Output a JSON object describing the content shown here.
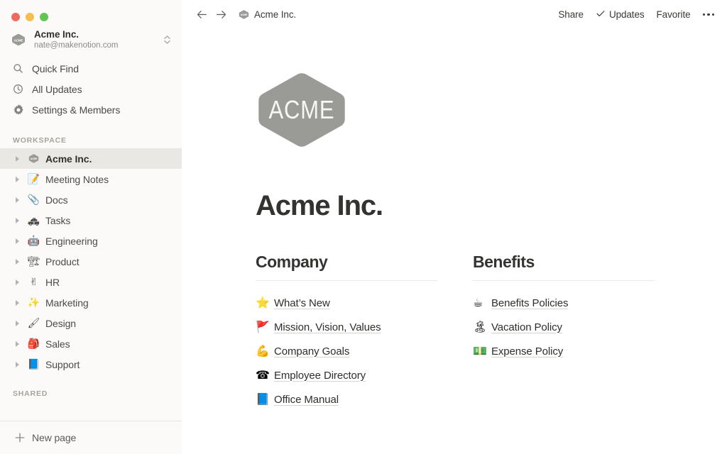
{
  "window": {
    "traffic_lights": [
      {
        "name": "close",
        "color": "#ec6a5f"
      },
      {
        "name": "minimize",
        "color": "#f4bf4f"
      },
      {
        "name": "maximize",
        "color": "#61c554"
      }
    ]
  },
  "sidebar": {
    "workspace": {
      "name": "Acme Inc.",
      "email": "nate@makenotion.com",
      "logo_text": "ACME",
      "switcher_icon": "chevron-up-down-icon"
    },
    "nav": [
      {
        "label": "Quick Find",
        "icon": "search-icon"
      },
      {
        "label": "All Updates",
        "icon": "clock-icon"
      },
      {
        "label": "Settings & Members",
        "icon": "gear-icon"
      }
    ],
    "workspace_section": {
      "title": "WORKSPACE",
      "pages": [
        {
          "label": "Acme Inc.",
          "emoji": "",
          "icon": "acme-hex-icon",
          "selected": true
        },
        {
          "label": "Meeting Notes",
          "emoji": "📝",
          "icon": "memo-emoji",
          "selected": false
        },
        {
          "label": "Docs",
          "emoji": "📎",
          "icon": "paperclip-emoji",
          "selected": false
        },
        {
          "label": "Tasks",
          "emoji": "🚓",
          "icon": "police-car-emoji",
          "selected": false
        },
        {
          "label": "Engineering",
          "emoji": "🤖",
          "icon": "robot-emoji",
          "selected": false
        },
        {
          "label": "Product",
          "emoji": "🏗",
          "icon": "crane-emoji",
          "selected": false
        },
        {
          "label": "HR",
          "emoji": "✌",
          "icon": "victory-hand-emoji",
          "selected": false
        },
        {
          "label": "Marketing",
          "emoji": "✨",
          "icon": "sparkles-emoji",
          "selected": false
        },
        {
          "label": "Design",
          "emoji": "🖌",
          "icon": "paintbrush-emoji",
          "selected": false
        },
        {
          "label": "Sales",
          "emoji": "🎒",
          "icon": "backpack-emoji",
          "selected": false
        },
        {
          "label": "Support",
          "emoji": "📘",
          "icon": "blue-book-emoji",
          "selected": false
        }
      ]
    },
    "shared_section": {
      "title": "SHARED",
      "pages": []
    },
    "new_page": {
      "label": "New page",
      "icon": "plus-icon"
    }
  },
  "topbar": {
    "back_icon": "arrow-left-icon",
    "forward_icon": "arrow-right-icon",
    "breadcrumb": {
      "label": "Acme Inc.",
      "icon": "acme-hex-icon"
    },
    "actions": [
      {
        "label": "Share",
        "icon": ""
      },
      {
        "label": "Updates",
        "icon": "check-icon"
      },
      {
        "label": "Favorite",
        "icon": ""
      }
    ],
    "more_icon": "ellipsis-icon"
  },
  "page": {
    "logo_text": "ACME",
    "title": "Acme Inc.",
    "columns": [
      {
        "heading": "Company",
        "links": [
          {
            "label": "What’s New",
            "emoji": "⭐",
            "icon": "star-emoji"
          },
          {
            "label": "Mission, Vision, Values",
            "emoji": "🚩",
            "icon": "triangular-flag-emoji"
          },
          {
            "label": "Company Goals",
            "emoji": "💪",
            "icon": "flexed-biceps-emoji"
          },
          {
            "label": "Employee Directory",
            "emoji": "☎",
            "icon": "telephone-emoji"
          },
          {
            "label": "Office Manual",
            "emoji": "📘",
            "icon": "blue-book-emoji"
          }
        ]
      },
      {
        "heading": "Benefits",
        "links": [
          {
            "label": "Benefits Policies",
            "emoji": "☕",
            "icon": "hot-beverage-emoji"
          },
          {
            "label": "Vacation Policy",
            "emoji": "🏝",
            "icon": "desert-island-emoji"
          },
          {
            "label": "Expense Policy",
            "emoji": "💵",
            "icon": "dollar-banknote-emoji"
          }
        ]
      }
    ]
  },
  "colors": {
    "sidebar_bg": "#fbfaf9",
    "selected_row": "#e9e8e5",
    "logo_gray": "#9a9a96",
    "text_primary": "#333330",
    "text_secondary": "#8b8a85",
    "divider": "#ebeae7"
  }
}
